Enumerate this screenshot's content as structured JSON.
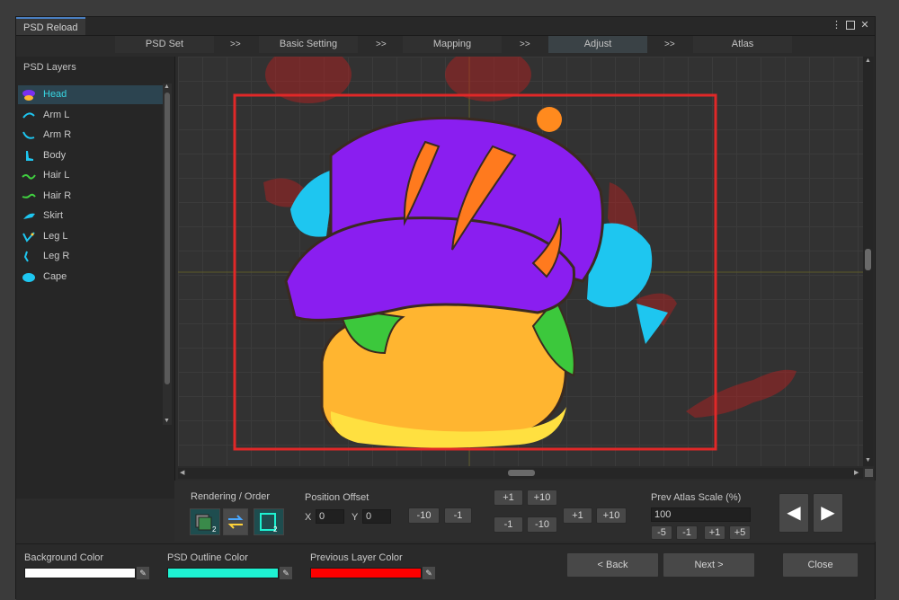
{
  "window": {
    "title": "PSD Reload",
    "menu_glyph": "⋮",
    "close_glyph": "✕"
  },
  "steps": [
    {
      "label": "PSD Set",
      "active": false
    },
    {
      "label": "Basic Setting",
      "active": false
    },
    {
      "label": "Mapping",
      "active": false
    },
    {
      "label": "Adjust",
      "active": true
    },
    {
      "label": "Atlas",
      "active": false
    }
  ],
  "step_separator": ">>",
  "sidebar": {
    "title": "PSD Layers",
    "layers": [
      {
        "label": "Head",
        "icon": "head-icon",
        "color": "#7a2ff0",
        "active": true
      },
      {
        "label": "Arm L",
        "icon": "arm-l-icon",
        "color": "#1ec6f0"
      },
      {
        "label": "Arm R",
        "icon": "arm-r-icon",
        "color": "#1ec6f0"
      },
      {
        "label": "Body",
        "icon": "body-icon",
        "color": "#1ec6f0"
      },
      {
        "label": "Hair L",
        "icon": "hair-l-icon",
        "color": "#40d040"
      },
      {
        "label": "Hair R",
        "icon": "hair-r-icon",
        "color": "#40d040"
      },
      {
        "label": "Skirt",
        "icon": "skirt-icon",
        "color": "#1ec6f0"
      },
      {
        "label": "Leg L",
        "icon": "leg-l-icon",
        "color": "#1ec6f0"
      },
      {
        "label": "Leg R",
        "icon": "leg-r-icon",
        "color": "#1ec6f0"
      },
      {
        "label": "Cape",
        "icon": "cape-icon",
        "color": "#1ec6f0"
      }
    ],
    "scroll_up_glyph": "▲",
    "scroll_down_glyph": "▼"
  },
  "canvas": {
    "frame_color": "#e02828",
    "scroll_up_glyph": "▲",
    "scroll_down_glyph": "▼",
    "scroll_left_glyph": "◀",
    "scroll_right_glyph": "▶"
  },
  "controls": {
    "rendering_label": "Rendering / Order",
    "position_offset_label": "Position Offset",
    "x_label": "X",
    "x_value": "0",
    "y_label": "Y",
    "y_value": "0",
    "btn_x_minus10": "-10",
    "btn_x_minus1": "-1",
    "btn_y_plus1": "+1",
    "btn_y_plus10": "+10",
    "btn_y_minus1": "-1",
    "btn_y_minus10": "-10",
    "btn_x_plus1": "+1",
    "btn_x_plus10": "+10",
    "atlas_scale_label": "Prev Atlas Scale (%)",
    "atlas_scale_value": "100",
    "scale_minus5": "-5",
    "scale_minus1": "-1",
    "scale_plus1": "+1",
    "scale_plus5": "+5",
    "prev_glyph": "◀",
    "next_glyph": "▶"
  },
  "footer": {
    "background_color_label": "Background Color",
    "background_color": "#ffffff",
    "outline_color_label": "PSD Outline Color",
    "outline_color": "#1ef2d2",
    "prev_layer_color_label": "Previous Layer Color",
    "prev_layer_color": "#ff0000",
    "picker_glyph": "✎",
    "back_label": "< Back",
    "next_label": "Next >",
    "close_label": "Close"
  }
}
